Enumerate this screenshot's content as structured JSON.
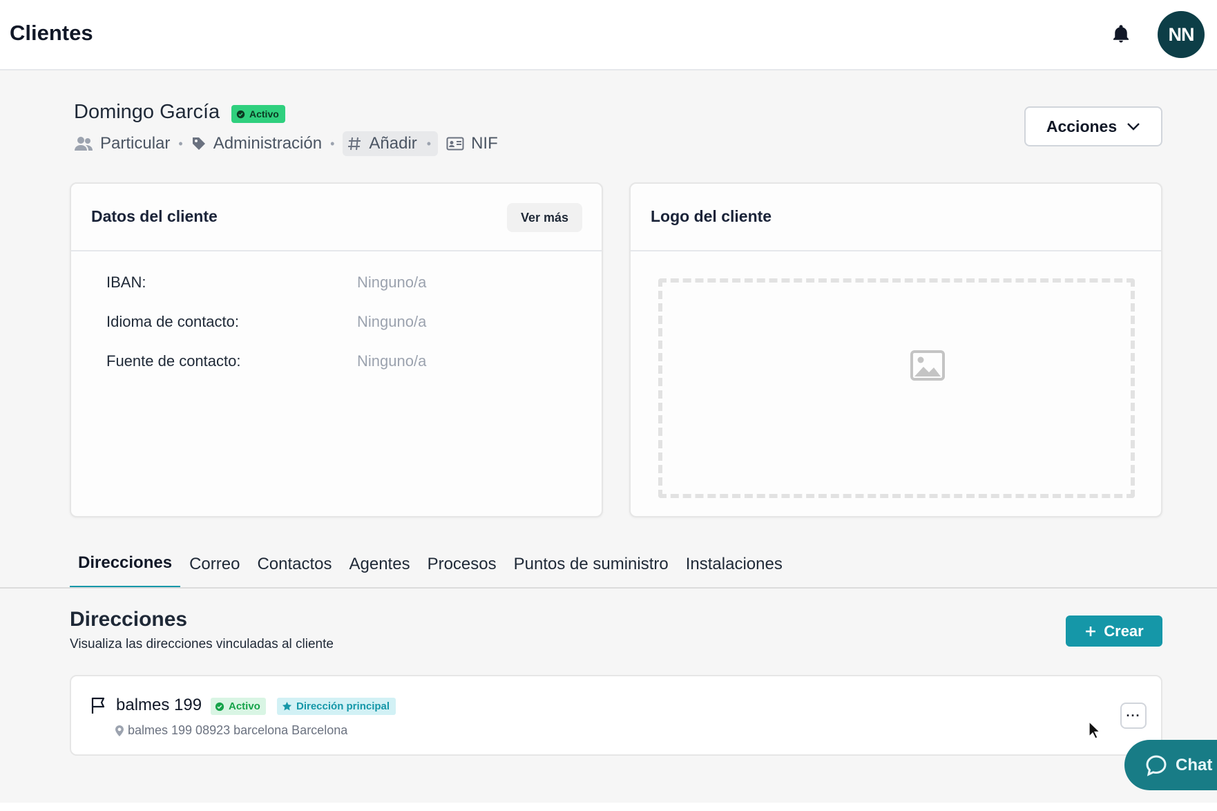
{
  "header": {
    "title": "Clientes",
    "avatar_initials": "NN"
  },
  "client": {
    "name": "Domingo García",
    "status": "Activo",
    "meta": {
      "type": "Particular",
      "tag": "Administración",
      "add_label": "Añadir",
      "id_label": "NIF"
    },
    "actions_label": "Acciones"
  },
  "datos_card": {
    "title": "Datos del cliente",
    "ver_mas": "Ver más",
    "rows": [
      {
        "label": "IBAN:",
        "value": "Ninguno/a"
      },
      {
        "label": "Idioma de contacto:",
        "value": "Ninguno/a"
      },
      {
        "label": "Fuente de contacto:",
        "value": "Ninguno/a"
      }
    ]
  },
  "logo_card": {
    "title": "Logo del cliente"
  },
  "tabs": [
    {
      "label": "Direcciones",
      "active": true
    },
    {
      "label": "Correo"
    },
    {
      "label": "Contactos"
    },
    {
      "label": "Agentes"
    },
    {
      "label": "Procesos"
    },
    {
      "label": "Puntos de suministro"
    },
    {
      "label": "Instalaciones"
    }
  ],
  "direcciones": {
    "title": "Direcciones",
    "subtitle": "Visualiza las direcciones vinculadas al cliente",
    "create_label": "Crear",
    "items": [
      {
        "name": "balmes 199",
        "status": "Activo",
        "principal_label": "Dirección principal",
        "address": "balmes 199 08923 barcelona Barcelona",
        "more_label": "···"
      }
    ]
  },
  "chat": {
    "label": "Chat"
  },
  "colors": {
    "accent": "#1597a8",
    "avatar_bg": "#0d3e47",
    "active_badge": "#2fd07e",
    "chat_bg": "#187c86"
  },
  "icons": {
    "bell": "bell-icon",
    "people": "people-icon",
    "tag": "tag-icon",
    "hash": "hash-icon",
    "id_card": "id-card-icon",
    "chevron": "chevron-down-icon",
    "image": "image-placeholder-icon",
    "plus": "plus-icon",
    "flag": "flag-icon",
    "star": "star-icon",
    "pin": "map-pin-icon",
    "check": "check-circle-icon",
    "chat": "chat-bubble-icon"
  }
}
